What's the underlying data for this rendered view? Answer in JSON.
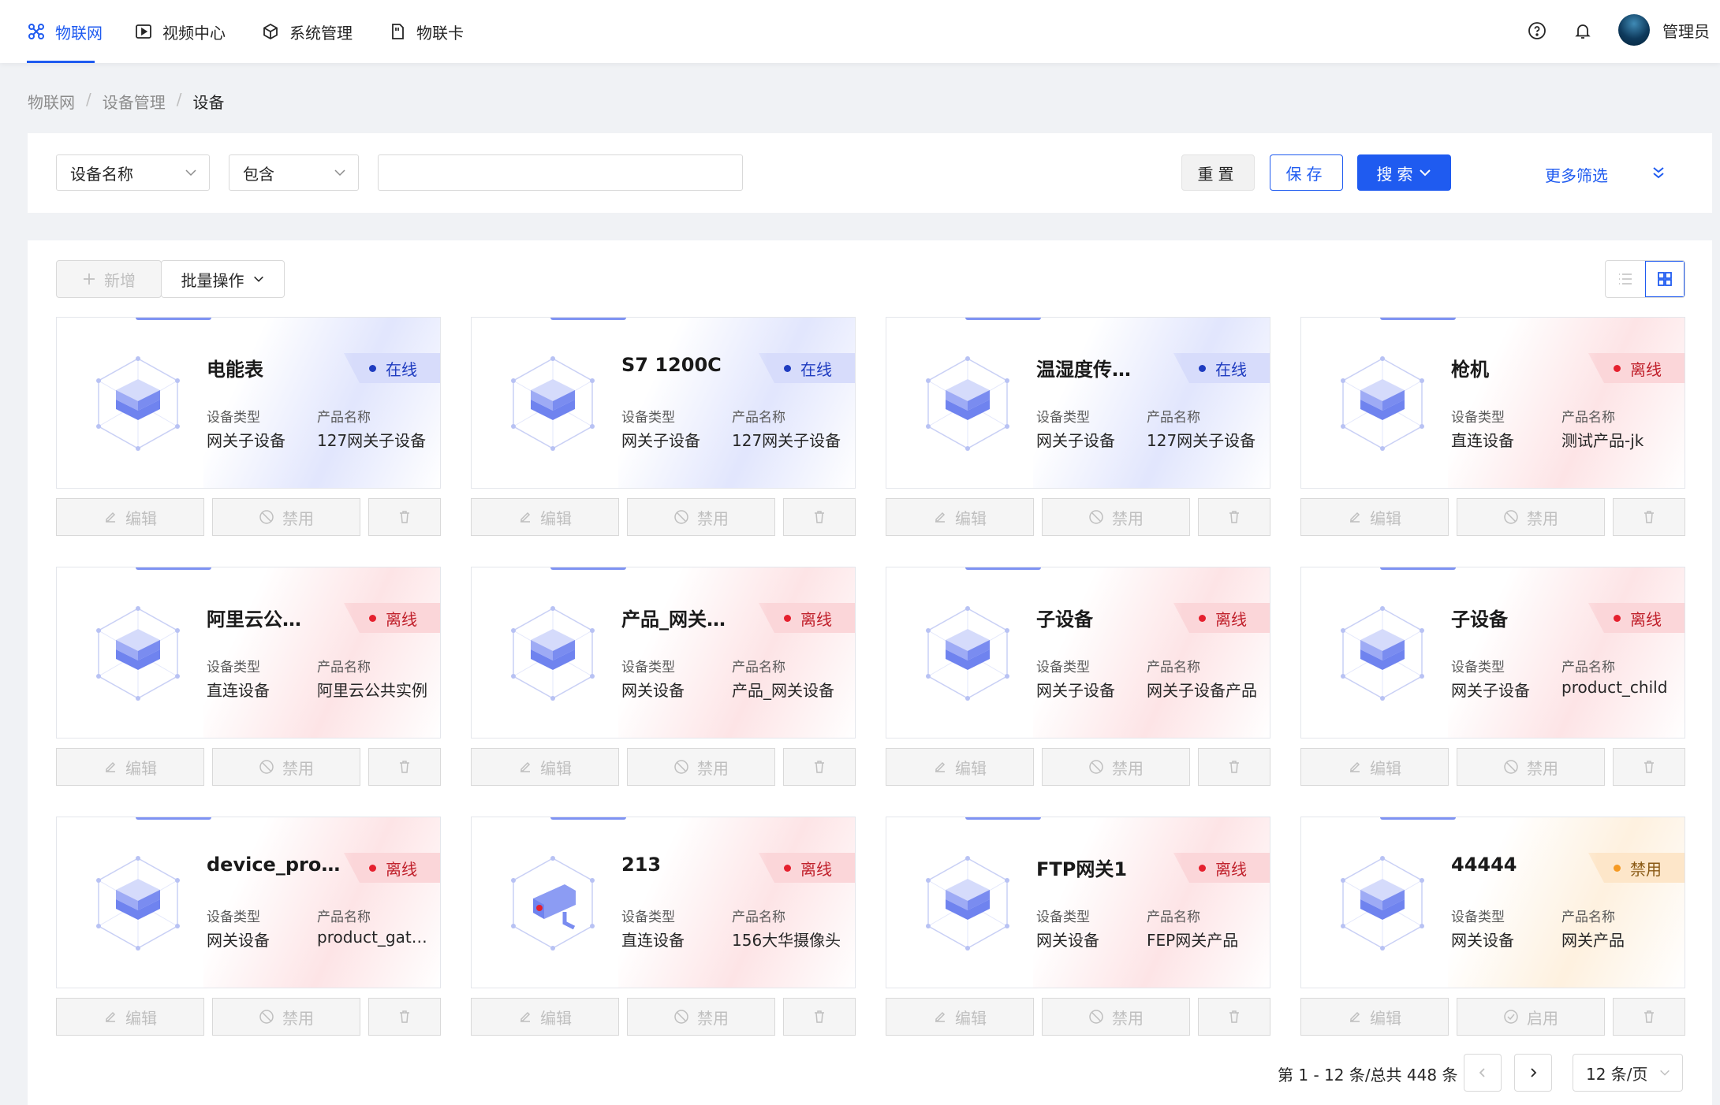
{
  "nav": {
    "items": [
      {
        "label": "物联网",
        "icon": "iot-icon",
        "active": true
      },
      {
        "label": "视频中心",
        "icon": "play-icon"
      },
      {
        "label": "系统管理",
        "icon": "cube-icon"
      },
      {
        "label": "物联卡",
        "icon": "sim-card-icon"
      }
    ],
    "user": "管理员"
  },
  "breadcrumb": [
    "物联网",
    "设备管理",
    "设备"
  ],
  "filter": {
    "field": "设备名称",
    "operator": "包含",
    "value": "",
    "reset": "重置",
    "save": "保存",
    "search": "搜索",
    "more": "更多筛选"
  },
  "toolbar": {
    "add": "新增",
    "batch": "批量操作"
  },
  "cards_labels": {
    "type": "设备类型",
    "product": "产品名称",
    "edit": "编辑",
    "disable": "禁用",
    "enable": "启用"
  },
  "devices": [
    {
      "name": "电能表",
      "status": "在线",
      "state": "online",
      "type": "网关子设备",
      "product": "127网关子设备",
      "icon": "cube"
    },
    {
      "name": "S7 1200C",
      "status": "在线",
      "state": "online",
      "type": "网关子设备",
      "product": "127网关子设备",
      "icon": "cube"
    },
    {
      "name": "温湿度传感器",
      "status": "在线",
      "state": "online",
      "type": "网关子设备",
      "product": "127网关子设备",
      "icon": "cube"
    },
    {
      "name": "枪机",
      "status": "离线",
      "state": "offline",
      "type": "直连设备",
      "product": "测试产品-jk",
      "icon": "cube"
    },
    {
      "name": "阿里云公共实例",
      "status": "离线",
      "state": "offline",
      "type": "直连设备",
      "product": "阿里云公共实例",
      "icon": "cube"
    },
    {
      "name": "产品_网关设备",
      "status": "离线",
      "state": "offline",
      "type": "网关设备",
      "product": "产品_网关设备",
      "icon": "cube"
    },
    {
      "name": "子设备",
      "status": "离线",
      "state": "offline",
      "type": "网关子设备",
      "product": "网关子设备产品",
      "icon": "cube"
    },
    {
      "name": "子设备",
      "status": "离线",
      "state": "offline",
      "type": "网关子设备",
      "product": "product_child",
      "icon": "cube"
    },
    {
      "name": "device_product",
      "status": "离线",
      "state": "offline",
      "type": "网关设备",
      "product": "product_gateway",
      "icon": "cube"
    },
    {
      "name": "213",
      "status": "离线",
      "state": "offline",
      "type": "直连设备",
      "product": "156大华摄像头",
      "icon": "camera"
    },
    {
      "name": "FTP网关1",
      "status": "离线",
      "state": "offline",
      "type": "网关设备",
      "product": "FEP网关产品",
      "icon": "cube"
    },
    {
      "name": "44444",
      "status": "禁用",
      "state": "disabled",
      "type": "网关设备",
      "product": "网关产品",
      "icon": "cube"
    }
  ],
  "pagination": {
    "summary": "第 1 - 12 条/总共 448 条",
    "page_size": "12 条/页"
  },
  "colors": {
    "primary": "#1f5bf0",
    "online": "#1f3cc0",
    "offline": "#e5202e",
    "disabled": "#f59a23"
  }
}
